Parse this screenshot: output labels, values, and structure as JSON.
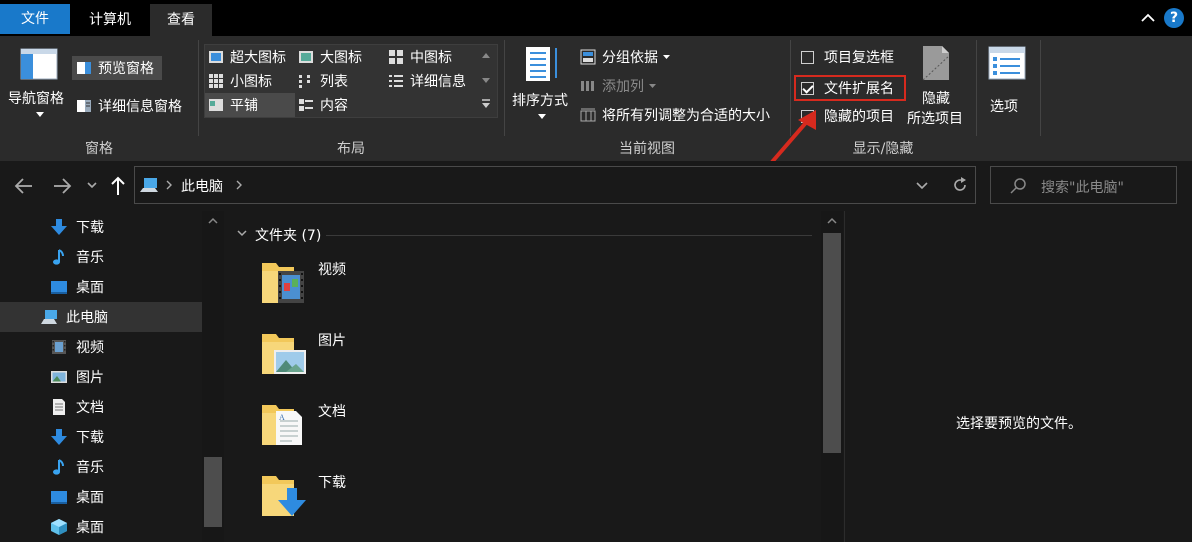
{
  "tabs": {
    "file": "文件",
    "computer": "计算机",
    "view": "查看"
  },
  "ribbon": {
    "panes": {
      "nav_pane": "导航窗格",
      "preview_pane": "预览窗格",
      "details_pane": "详细信息窗格",
      "group_label": "窗格"
    },
    "layout": {
      "extra_large": "超大图标",
      "large": "大图标",
      "medium": "中图标",
      "small": "小图标",
      "list": "列表",
      "details": "详细信息",
      "tiles": "平铺",
      "content": "内容",
      "group_label": "布局"
    },
    "current_view": {
      "sort_by": "排序方式",
      "group_by": "分组依据",
      "add_column": "添加列",
      "fit_columns": "将所有列调整为合适的大小",
      "group_label": "当前视图"
    },
    "show_hide": {
      "item_checkboxes": "项目复选框",
      "file_extensions": "文件扩展名",
      "hidden_items": "隐藏的项目",
      "hide_selected_1": "隐藏",
      "hide_selected_2": "所选项目",
      "group_label": "显示/隐藏",
      "item_checkboxes_checked": false,
      "file_extensions_checked": true,
      "hidden_items_checked": false
    },
    "options": "选项"
  },
  "address": {
    "path": "此电脑",
    "search_placeholder": "搜索\"此电脑\""
  },
  "nav": {
    "items": [
      {
        "label": "下载",
        "icon": "download-icon"
      },
      {
        "label": "音乐",
        "icon": "music-icon"
      },
      {
        "label": "桌面",
        "icon": "desktop-icon"
      },
      {
        "label": "此电脑",
        "icon": "this-pc-icon"
      },
      {
        "label": "视频",
        "icon": "video-icon"
      },
      {
        "label": "图片",
        "icon": "pictures-icon"
      },
      {
        "label": "文档",
        "icon": "documents-icon"
      },
      {
        "label": "下载",
        "icon": "download-icon"
      },
      {
        "label": "音乐",
        "icon": "music-icon"
      },
      {
        "label": "桌面",
        "icon": "desktop-icon"
      },
      {
        "label": "桌面",
        "icon": "3d-desktop-icon"
      }
    ]
  },
  "content": {
    "section_header": "文件夹 (7)",
    "folders": [
      {
        "label": "视频",
        "icon": "video-folder-icon"
      },
      {
        "label": "图片",
        "icon": "pictures-folder-icon"
      },
      {
        "label": "文档",
        "icon": "documents-folder-icon"
      },
      {
        "label": "下载",
        "icon": "downloads-folder-icon"
      }
    ]
  },
  "preview": {
    "message": "选择要预览的文件。"
  },
  "colors": {
    "accent_blue": "#1979ca",
    "highlight_red": "#e02020",
    "ribbon_bg": "#2b2b2b",
    "window_bg": "#191919"
  }
}
